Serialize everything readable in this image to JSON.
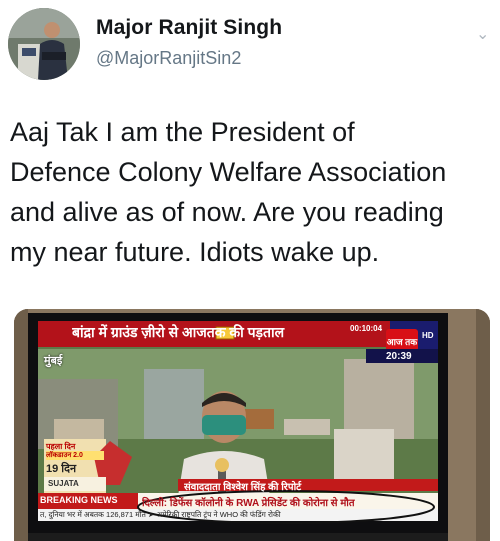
{
  "author": {
    "display_name": "Major Ranjit Singh",
    "handle": "@MajorRanjitSin2"
  },
  "tweet": {
    "lines": [
      "Aaj Tak I am the President of",
      "Defence Colony Welfare Association",
      "and alive as of now. Are you reading",
      "my near future. Idiots wake up."
    ]
  },
  "media": {
    "headline": "बांद्रा में ग्राउंड ज़ीरो से आजतक की पड़ताल",
    "channel_logo": "आज तक",
    "hd": "HD",
    "time_top": "00:10:04",
    "clock": "20:39",
    "city": "मुंबई",
    "day_label": "पहला दिन",
    "lockdown": "लॉकडाउन 2.0",
    "day_count": "19 दिन",
    "reporter_banner": "संवाददाता विश्वेश सिंह की रिपोर्ट",
    "breaking_label": "BREAKING NEWS",
    "breaking_text": "दिल्ली: डिफेंस कॉलोनी के RWA प्रेसिडेंट की कोरोना से मौत",
    "ticker_text": "त, दुनिया भर में अबतक 126,871 मौत ➤ अमेरिकी राष्ट्रपति ट्रंप ने WHO की फंडिंग रोकी",
    "sujata": "SUJATA"
  }
}
